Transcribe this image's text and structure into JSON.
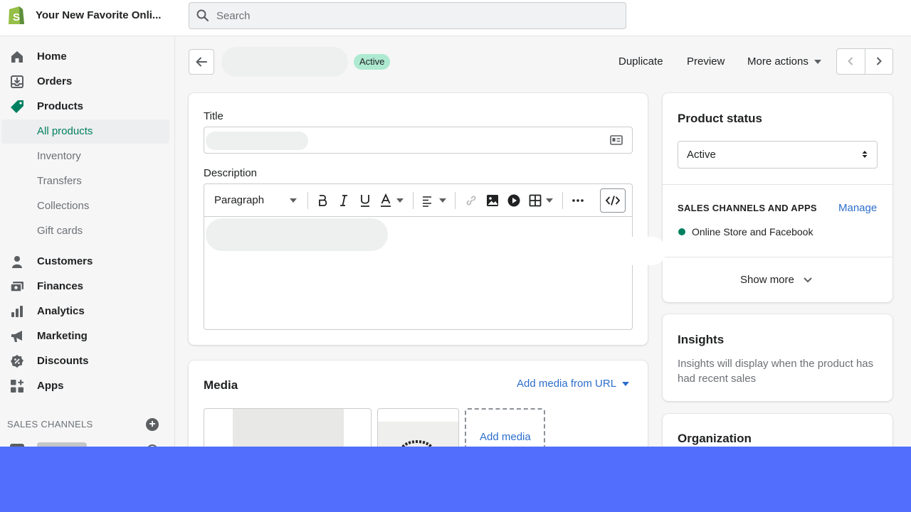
{
  "topbar": {
    "store_name": "Your New Favorite Onli...",
    "search_placeholder": "Search"
  },
  "sidebar": {
    "items": [
      {
        "label": "Home",
        "icon": "home-icon"
      },
      {
        "label": "Orders",
        "icon": "orders-icon"
      },
      {
        "label": "Products",
        "icon": "tag-icon"
      },
      {
        "label": "Customers",
        "icon": "person-icon"
      },
      {
        "label": "Finances",
        "icon": "finances-icon"
      },
      {
        "label": "Analytics",
        "icon": "bar-chart-icon"
      },
      {
        "label": "Marketing",
        "icon": "megaphone-icon"
      },
      {
        "label": "Discounts",
        "icon": "discount-icon"
      },
      {
        "label": "Apps",
        "icon": "apps-icon"
      }
    ],
    "product_subitems": [
      "All products",
      "Inventory",
      "Transfers",
      "Collections",
      "Gift cards"
    ],
    "active_subitem": "All products",
    "sales_channels_heading": "SALES CHANNELS"
  },
  "header": {
    "status_badge": "Active",
    "duplicate_label": "Duplicate",
    "preview_label": "Preview",
    "more_actions_label": "More actions"
  },
  "product_form": {
    "title_label": "Title",
    "description_label": "Description",
    "toolbar": {
      "paragraph_select": "Paragraph"
    }
  },
  "media": {
    "title": "Media",
    "add_from_url_label": "Add media from URL",
    "add_media_label": "Add media"
  },
  "status_card": {
    "title": "Product status",
    "status_value": "Active",
    "sales_channels_heading": "SALES CHANNELS AND APPS",
    "manage_label": "Manage",
    "channel_label": "Online Store and Facebook",
    "show_more_label": "Show more"
  },
  "insights": {
    "title": "Insights",
    "text": "Insights will display when the product has had recent sales"
  },
  "organization": {
    "title": "Organization"
  },
  "colors": {
    "accent_green": "#008060",
    "link_blue": "#2c6ecb",
    "badge_green": "#aee9d1",
    "bottom_band": "#516ffc"
  }
}
